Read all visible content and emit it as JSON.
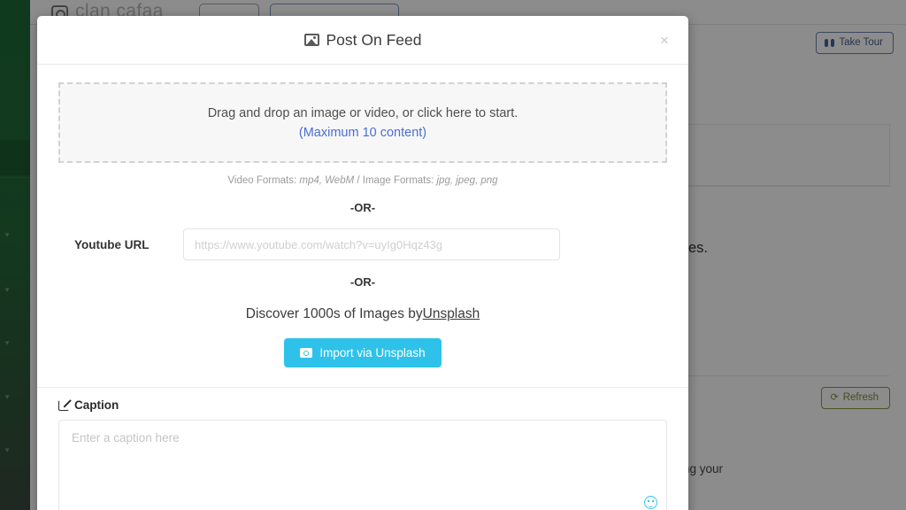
{
  "background": {
    "logo_text": "clan cafaa",
    "take_tour_label": "Take Tour",
    "take_tour_icon": "binoculars-icon",
    "refresh_label": "Refresh",
    "refresh_icon": "refresh-icon",
    "text_fragment_1": "es.",
    "text_fragment_2": "ng your",
    "sidebar_color": "#1d6b35",
    "take_tour_color": "#4a5d8a",
    "refresh_color": "#7f9034"
  },
  "modal": {
    "title": "Post On Feed",
    "title_icon": "image-icon",
    "close_icon": "close-icon",
    "close_label": "×",
    "dropzone": {
      "primary_text": "Drag and drop an image or video, or click here to start.",
      "link_text": "(Maximum 10 content)",
      "link_color": "#4a6fd4"
    },
    "formats": {
      "video_label": "Video Formats:",
      "video_value": "mp4, WebM",
      "separator": "/",
      "image_label": "Image Formats:",
      "image_value": "jpg, jpeg, png"
    },
    "or_separator": "-OR-",
    "youtube": {
      "label": "Youtube URL",
      "placeholder": "https://www.youtube.com/watch?v=uyIg0Hqz43g",
      "value": ""
    },
    "unsplash": {
      "prefix_text": "Discover 1000s of Images by",
      "link_text": "Unsplash",
      "button_label": "Import via Unsplash",
      "button_icon": "camera-icon",
      "button_color": "#2ec2ea"
    },
    "caption": {
      "label": "Caption",
      "label_icon": "edit-pencil-icon",
      "placeholder": "Enter a caption here",
      "value": "",
      "emoji_icon": "emoji-smiley-icon"
    }
  }
}
